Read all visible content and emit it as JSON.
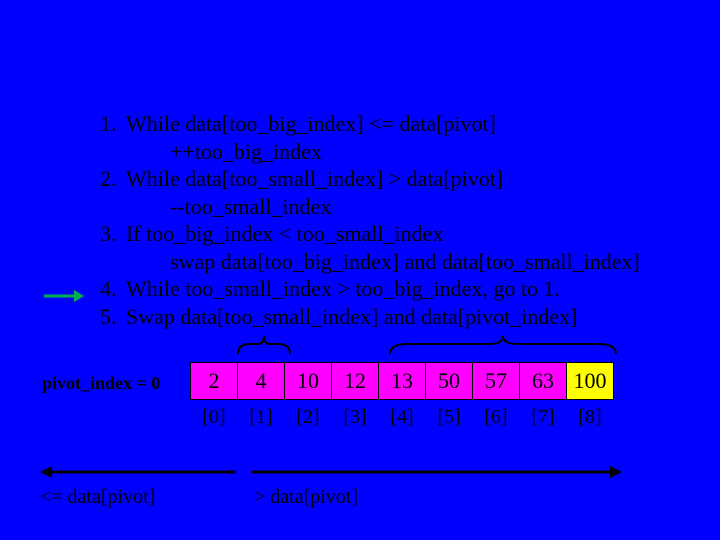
{
  "algo": {
    "step1": "While data[too_big_index] <= data[pivot]",
    "step1b": "++too_big_index",
    "step2": "While data[too_small_index] > data[pivot]",
    "step2b": "--too_small_index",
    "step3": "If too_big_index < too_small_index",
    "step3b": "swap data[too_big_index] and data[too_small_index]",
    "step4": "While too_small_index > too_big_index, go to 1.",
    "step5": "Swap data[too_small_index] and data[pivot_index]"
  },
  "pivot_label": "pivot_index = 0",
  "array": {
    "values": [
      "2",
      "4",
      "10",
      "12",
      "13",
      "50",
      "57",
      "63",
      "100"
    ],
    "colors": [
      "mag",
      "mag",
      "mag",
      "mag",
      "mag",
      "mag",
      "mag",
      "mag",
      "yel"
    ],
    "indices": [
      "[0]",
      "[1]",
      "[2]",
      "[3]",
      "[4]",
      "[5]",
      "[6]",
      "[7]",
      "[8]"
    ]
  },
  "le_label": "<= data[pivot]",
  "gt_label": "> data[pivot]"
}
